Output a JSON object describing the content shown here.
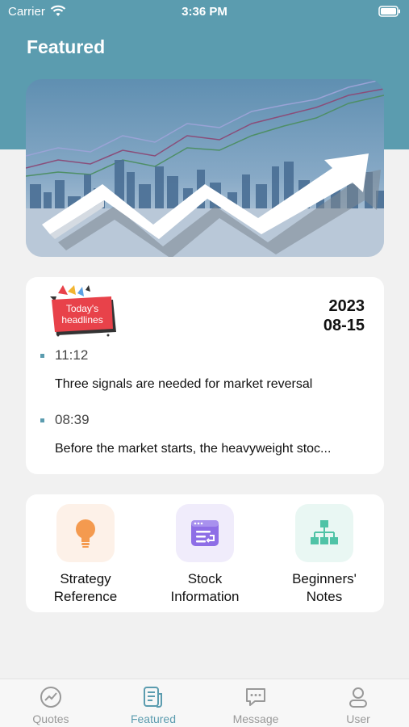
{
  "status": {
    "carrier": "Carrier",
    "time": "3:36 PM"
  },
  "header": {
    "title": "Featured"
  },
  "headlines": {
    "badge_line1": "Today's",
    "badge_line2": "headlines",
    "date_year": "2023",
    "date_day": "08-15",
    "items": [
      {
        "time": "11:12",
        "text": "Three signals are needed for market reversal"
      },
      {
        "time": "08:39",
        "text": "Before the market starts, the heavyweight stoc..."
      }
    ]
  },
  "tools": [
    {
      "line1": "Strategy",
      "line2": "Reference",
      "icon": "lightbulb-icon",
      "bg": "#fdf1e8",
      "color": "#f49a4f"
    },
    {
      "line1": "Stock",
      "line2": "Information",
      "icon": "news-list-icon",
      "bg": "#f0ecfb",
      "color": "#8e6ee6"
    },
    {
      "line1": "Beginners'",
      "line2": "Notes",
      "icon": "hierarchy-icon",
      "bg": "#e9f7f3",
      "color": "#4fc3a6"
    }
  ],
  "tabs": [
    {
      "label": "Quotes",
      "icon": "chart-circle-icon",
      "active": false
    },
    {
      "label": "Featured",
      "icon": "document-icon",
      "active": true
    },
    {
      "label": "Message",
      "icon": "chat-icon",
      "active": false
    },
    {
      "label": "User",
      "icon": "person-icon",
      "active": false
    }
  ],
  "colors": {
    "accent": "#5b9caf",
    "background": "#f1f1f1",
    "inactive": "#999999"
  }
}
